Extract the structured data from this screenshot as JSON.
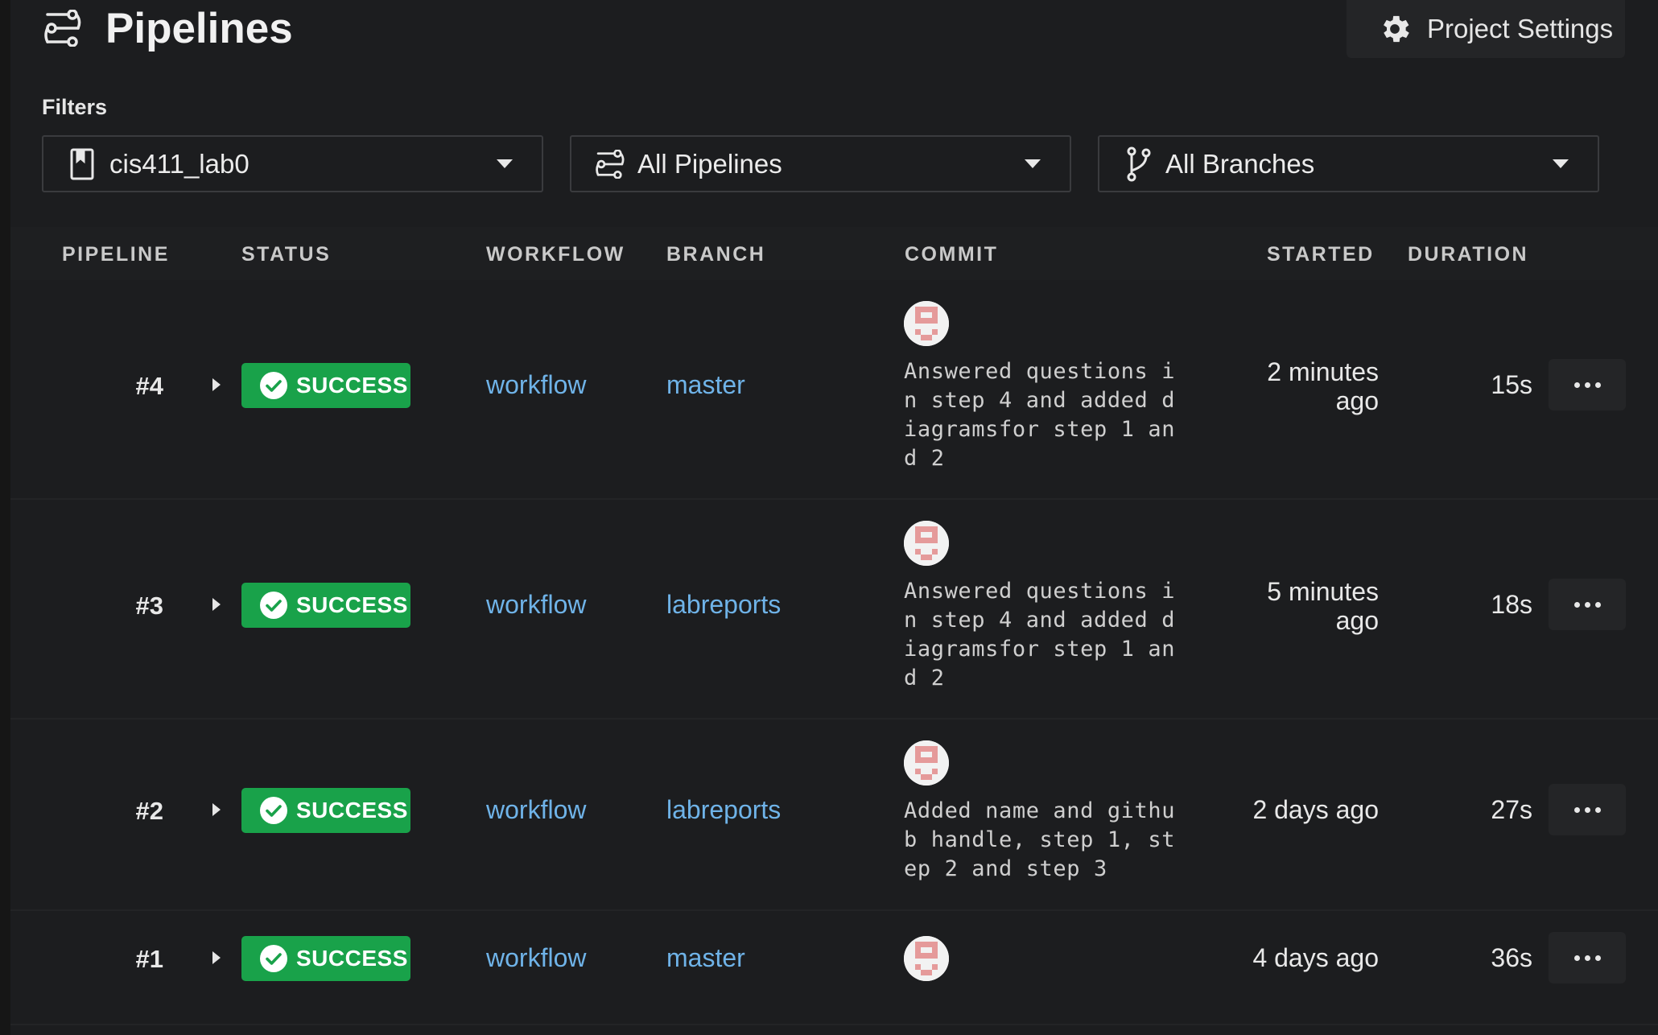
{
  "header": {
    "title": "Pipelines",
    "title_icon": "pipelines-icon",
    "settings_label": "Project Settings",
    "settings_icon": "gear-icon"
  },
  "filters": {
    "label": "Filters",
    "project": {
      "value": "cis411_lab0",
      "icon": "repo-icon"
    },
    "pipelines": {
      "value": "All Pipelines",
      "icon": "pipelines-icon"
    },
    "branches": {
      "value": "All Branches",
      "icon": "branch-icon"
    }
  },
  "table": {
    "columns": [
      "PIPELINE",
      "STATUS",
      "WORKFLOW",
      "BRANCH",
      "COMMIT",
      "STARTED",
      "DURATION"
    ],
    "rows": [
      {
        "number": "#4",
        "status": "SUCCESS",
        "workflow": "workflow",
        "branch": "master",
        "commit": "Answered questions i\nn step 4 and added d\niagramsfor step 1 an\nd 2",
        "started": "2 minutes\nago",
        "duration": "15s"
      },
      {
        "number": "#3",
        "status": "SUCCESS",
        "workflow": "workflow",
        "branch": "labreports",
        "commit": "Answered questions i\nn step 4 and added d\niagramsfor step 1 an\nd 2",
        "started": "5 minutes\nago",
        "duration": "18s"
      },
      {
        "number": "#2",
        "status": "SUCCESS",
        "workflow": "workflow",
        "branch": "labreports",
        "commit": "Added name and githu\nb handle, step 1, st\nep 2 and step 3",
        "started": "2 days ago",
        "duration": "27s"
      },
      {
        "number": "#1",
        "status": "SUCCESS",
        "workflow": "workflow",
        "branch": "master",
        "commit": "",
        "started": "4 days ago",
        "duration": "36s"
      }
    ]
  },
  "colors": {
    "background": "#1c1d1f",
    "success": "#19a24a",
    "link": "#6fb3e8"
  }
}
